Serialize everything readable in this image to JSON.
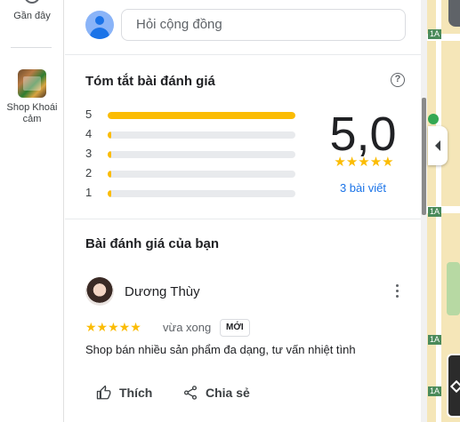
{
  "rail": {
    "recent_label": "Gần đây",
    "shop_label_line1": "Shop Khoái",
    "shop_label_line2": "cảm"
  },
  "community": {
    "placeholder": "Hỏi cộng đồng"
  },
  "summary": {
    "title": "Tóm tắt bài đánh giá",
    "help_icon": "?",
    "rows": [
      {
        "stars": "5",
        "fraction": 1.0
      },
      {
        "stars": "4",
        "fraction": 0.0
      },
      {
        "stars": "3",
        "fraction": 0.0
      },
      {
        "stars": "2",
        "fraction": 0.0
      },
      {
        "stars": "1",
        "fraction": 0.0
      }
    ],
    "score": "5,0",
    "score_stars": "★★★★★",
    "review_count": "3 bài viết"
  },
  "your_review": {
    "title": "Bài đánh giá của bạn",
    "reviewer_name": "Dương Thùy",
    "stars": "★★★★★",
    "time": "vừa xong",
    "badge": "MỚI",
    "text": "Shop bán nhiều sản phẩm đa dạng, tư vấn nhiệt tình",
    "like_label": "Thích",
    "share_label": "Chia sẻ"
  },
  "map": {
    "road_labels": [
      "1A",
      "1A",
      "1A",
      "1A"
    ]
  },
  "colors": {
    "accent_blue": "#1a73e8",
    "star_yellow": "#fbbc04",
    "bar_track": "#e8eaed"
  },
  "icons": [
    "clock-icon",
    "person-icon",
    "help-icon",
    "more-vert-icon",
    "thumb-up-icon",
    "share-icon",
    "collapse-arrow-icon",
    "layers-icon"
  ]
}
